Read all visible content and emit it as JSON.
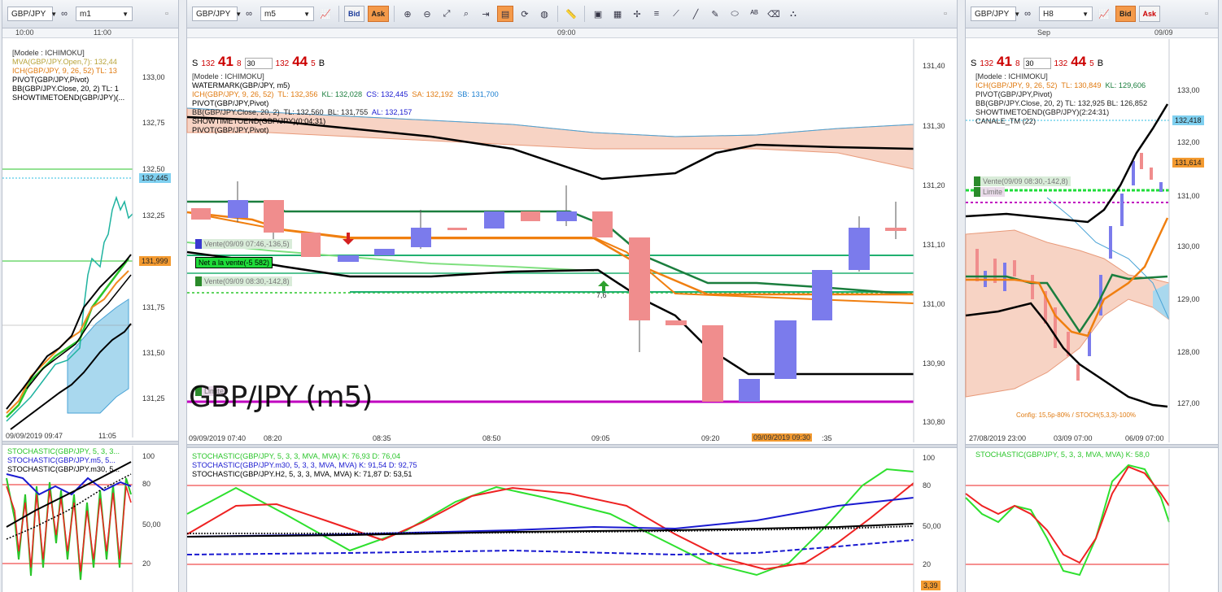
{
  "left": {
    "symbol": "GBP/JPY",
    "interval": "m1",
    "times": [
      "10:00",
      "11:00"
    ],
    "legend": [
      {
        "text": "[Modele : ICHIMOKU]",
        "color": "#333"
      },
      {
        "text": "MVA(GBP/JPY.Open,7): 132,44",
        "color": "#b8a33a"
      },
      {
        "text": "ICH(GBP/JPY, 9, 26, 52)  TL: 13",
        "color": "#e07a10"
      },
      {
        "text": "PIVOT(GBP/JPY,Pivot)",
        "color": "#000"
      },
      {
        "text": "BB(GBP/JPY.Close, 20, 2)  TL: 1",
        "color": "#000"
      },
      {
        "text": "SHOWTIMETOEND(GBP/JPY)(...",
        "color": "#000"
      }
    ],
    "yticks": [
      "133,00",
      "132,75",
      "132,50",
      "132,25",
      "132,00",
      "131,75",
      "131,50",
      "131,25"
    ],
    "price_tags": [
      {
        "text": "132,445",
        "bg": "#7fd0f0"
      },
      {
        "text": "131,999",
        "bg": "#f39a30"
      }
    ],
    "xlabels": [
      "09/09/2019 09:47",
      "11:05"
    ],
    "stoch_legend": [
      {
        "text": "STOCHASTIC(GBP/JPY, 5, 3, 3...",
        "color": "#2ac52a"
      },
      {
        "text": "STOCHASTIC(GBP/JPY.m5, 5...",
        "color": "#1a1ad0"
      },
      {
        "text": "STOCHASTIC(GBP/JPY.m30, 5...",
        "color": "#000"
      }
    ]
  },
  "middle": {
    "symbol": "GBP/JPY",
    "interval": "m5",
    "bid_label": "Bid",
    "ask_label": "Ask",
    "top_time": "09:00",
    "sell": {
      "label": "S",
      "prefix": "132",
      "big": "41",
      "sup": "8",
      "qty": "30"
    },
    "buy": {
      "label": "B",
      "prefix": "132",
      "big": "44",
      "sup": "5"
    },
    "legend": [
      {
        "text": "[Modele : ICHIMOKU]",
        "color": "#333"
      },
      {
        "text": "WATERMARK(GBP/JPY, m5)",
        "color": "#000"
      }
    ],
    "ich_legend": {
      "label": "ICH(GBP/JPY, 9, 26, 52)",
      "tl": "TL: 132,356",
      "kl": "KL: 132,028",
      "cs": "CS: 132,445",
      "sa": "SA: 132,192",
      "sb": "SB: 131,700"
    },
    "legend2": [
      {
        "text": "PIVOT(GBP/JPY,Pivot)",
        "color": "#000"
      }
    ],
    "bb_legend": {
      "label": "BB(GBP/JPY.Close, 20, 2)",
      "tl": "TL: 132,560",
      "bl": "BL: 131,755",
      "al": "AL: 132,157"
    },
    "legend3": [
      {
        "text": "SHOWTIMETOEND(GBP/JPY)(0:04:31)",
        "color": "#000"
      },
      {
        "text": "PIVOT(GBP/JPY,Pivot)",
        "color": "#000"
      }
    ],
    "yticks": [
      "131,40",
      "131,30",
      "131,20",
      "131,10",
      "131,00",
      "130,90",
      "130,80"
    ],
    "orders": [
      {
        "text": "Vente(09/09 07:46,-136,5)"
      },
      {
        "text": "Net a la vente(-5 582)"
      },
      {
        "text": "Vente(09/09 08:30,-142,8)"
      },
      {
        "text": "Limite"
      }
    ],
    "marker_value": "7,6",
    "watermark": "GBP/JPY (m5)",
    "xlabels": [
      "09/09/2019 07:40",
      "08:20",
      "08:35",
      "08:50",
      "09:05",
      "09:20",
      "09/09/2019 09:30",
      ":35"
    ],
    "stoch_legend": [
      {
        "text": "STOCHASTIC(GBP/JPY, 5, 3, 3, MVA, MVA)  K: 76,93  D: 76,04",
        "color": "#2ac52a"
      },
      {
        "text": "STOCHASTIC(GBP/JPY.m30, 5, 3, 3, MVA, MVA)  K: 91,54  D: 92,75",
        "color": "#1a1ad0"
      },
      {
        "text": "STOCHASTIC(GBP/JPY.H2, 5, 3, 3, MVA, MVA)  K: 71,87  D: 53,51",
        "color": "#000"
      }
    ],
    "stoch_ticks": [
      "100",
      "80",
      "50,00",
      "20"
    ],
    "stoch_value": "3,39"
  },
  "right": {
    "symbol": "GBP/JPY",
    "interval": "H8",
    "times": [
      "Sep",
      "09/09"
    ],
    "sell": {
      "label": "S",
      "prefix": "132",
      "big": "41",
      "sup": "8",
      "qty": "30"
    },
    "buy": {
      "label": "B",
      "prefix": "132",
      "big": "44",
      "sup": "5"
    },
    "legend": [
      {
        "text": "[Modele : ICHIMOKU]",
        "color": "#333"
      }
    ],
    "ich_legend": {
      "label": "ICH(GBP/JPY, 9, 26, 52)",
      "tl": "TL: 130,849",
      "kl": "KL: 129,606"
    },
    "legend2": [
      {
        "text": "PIVOT(GBP/JPY,Pivot)",
        "color": "#000"
      },
      {
        "text": "BB(GBP/JPY.Close, 20, 2)  TL: 132,925  BL: 126,852",
        "color": "#000"
      },
      {
        "text": "SHOWTIMETOEND(GBP/JPY)(2:24:31)",
        "color": "#000"
      },
      {
        "text": "CANALE_TM (22)",
        "color": "#000"
      }
    ],
    "yticks": [
      "133,00",
      "132,00",
      "131,00",
      "130,00",
      "129,00",
      "128,00",
      "127,00"
    ],
    "price_tags": [
      {
        "text": "132,418",
        "bg": "#7fd0f0"
      },
      {
        "text": "131,614",
        "bg": "#f39a30"
      }
    ],
    "orders": [
      {
        "text": "Vente(09/09 08:30,-142,8)"
      },
      {
        "text": "Limite"
      }
    ],
    "config_note": "Config: 15,5p-80% / STOCH(5,3,3)-100%",
    "xlabels": [
      "27/08/2019 23:00",
      "03/09 07:00",
      "06/09 07:00"
    ],
    "stoch_legend": [
      {
        "text": "STOCHASTIC(GBP/JPY, 5, 3, 3, MVA, MVA)  K: 58,0",
        "color": "#2ac52a"
      }
    ]
  }
}
